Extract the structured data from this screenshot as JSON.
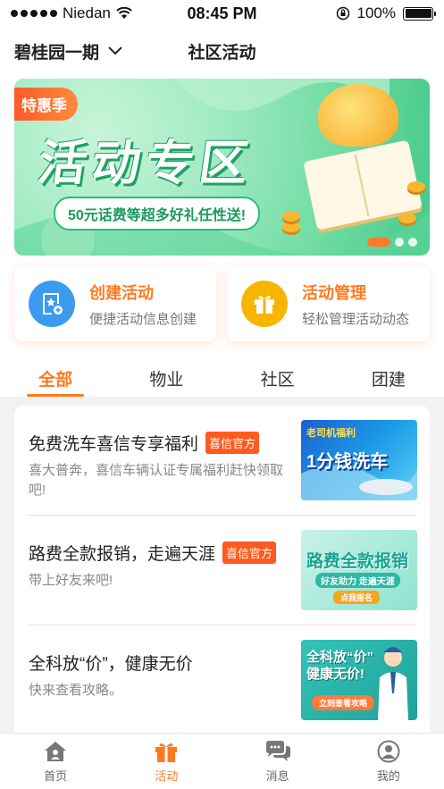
{
  "status_bar": {
    "carrier": "Niedan",
    "time": "08:45 PM",
    "battery": "100%"
  },
  "header": {
    "community": "碧桂园一期",
    "title": "社区活动"
  },
  "banner": {
    "tag": "特惠季",
    "headline": "活动专区",
    "subline": "50元话费等超多好礼任性送!"
  },
  "shortcuts": [
    {
      "title": "创建活动",
      "subtitle": "便捷活动信息创建",
      "icon": "star-add-icon",
      "color": "#3a9bef"
    },
    {
      "title": "活动管理",
      "subtitle": "轻松管理活动动态",
      "icon": "gift-icon",
      "color": "#f7b500"
    }
  ],
  "tabs": [
    "全部",
    "物业",
    "社区",
    "团建"
  ],
  "active_tab": "全部",
  "activities": [
    {
      "title": "免费洗车喜信专享福利",
      "badge": "喜信官方",
      "desc": "喜大普奔，喜信车辆认证专属福利赶快领取吧!",
      "thumb_text": "1分钱洗车",
      "thumb_sub": "老司机福利"
    },
    {
      "title": "路费全款报销，走遍天涯",
      "badge": "喜信官方",
      "desc": "带上好友来吧!",
      "thumb_text": "路费全款报销",
      "thumb_sub": "好友助力 走遍天涯",
      "thumb_btn": "点我报名"
    },
    {
      "title": "全科放“价”，健康无价",
      "badge": "",
      "desc": "快来查看攻略。",
      "thumb_text": "全科放“价” 健康无价!",
      "thumb_btn": "立刻查看攻略"
    }
  ],
  "bottom_nav": [
    {
      "label": "首页",
      "icon": "home-icon"
    },
    {
      "label": "活动",
      "icon": "gift-icon"
    },
    {
      "label": "消息",
      "icon": "chat-icon"
    },
    {
      "label": "我的",
      "icon": "user-icon"
    }
  ],
  "colors": {
    "accent": "#ff7a1f",
    "badge": "#ff5a1f"
  }
}
